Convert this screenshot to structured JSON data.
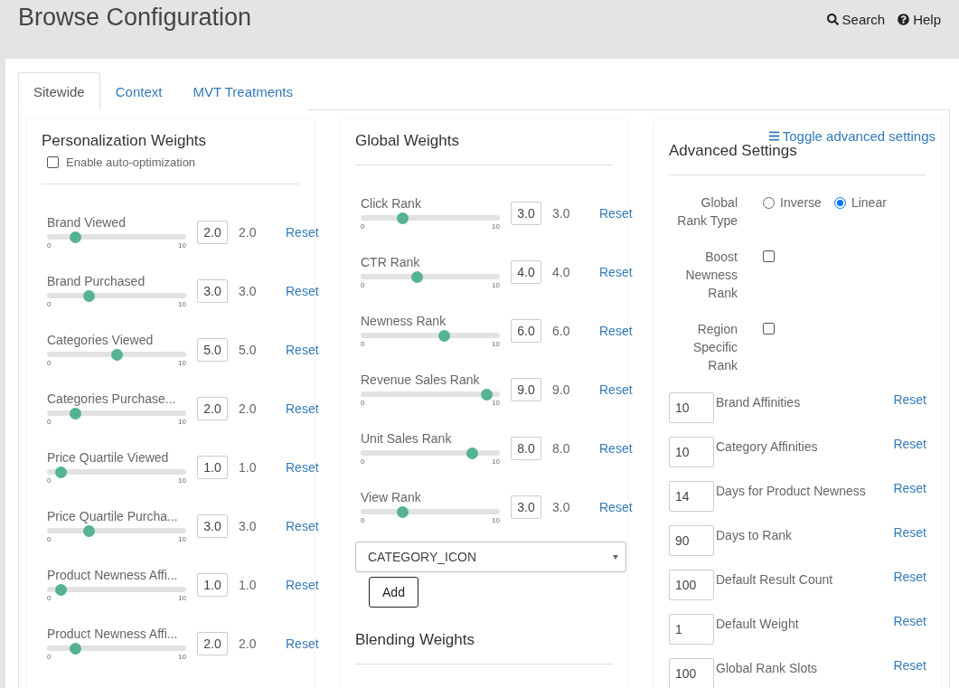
{
  "header": {
    "title": "Browse Configuration",
    "links": [
      {
        "kind": "search",
        "label": "Search"
      },
      {
        "kind": "help",
        "label": "Help"
      }
    ]
  },
  "tabs": [
    {
      "label": "Sitewide",
      "selected": true
    },
    {
      "label": "Context",
      "selected": false
    },
    {
      "label": "MVT Treatments",
      "selected": false
    }
  ],
  "personalization": {
    "title": "Personalization Weights",
    "auto_optimization": {
      "label": "Enable auto-optimization",
      "checked": false
    },
    "sliders": [
      {
        "label": "Brand Viewed",
        "level": 0.2,
        "min": "0",
        "max": "10",
        "input": "2.0",
        "value": "2.0",
        "reset": "Reset"
      },
      {
        "label": "Brand Purchased",
        "level": 0.3,
        "min": "0",
        "max": "10",
        "input": "3.0",
        "value": "3.0",
        "reset": "Reset"
      },
      {
        "label": "Categories Viewed",
        "level": 0.5,
        "min": "0",
        "max": "10",
        "input": "5.0",
        "value": "5.0",
        "reset": "Reset"
      },
      {
        "label": "Categories Purchase...",
        "level": 0.2,
        "min": "0",
        "max": "10",
        "input": "2.0",
        "value": "2.0",
        "reset": "Reset"
      },
      {
        "label": "Price Quartile Viewed",
        "level": 0.1,
        "min": "0",
        "max": "10",
        "input": "1.0",
        "value": "1.0",
        "reset": "Reset"
      },
      {
        "label": "Price Quartile Purcha...",
        "level": 0.3,
        "min": "0",
        "max": "10",
        "input": "3.0",
        "value": "3.0",
        "reset": "Reset"
      },
      {
        "label": "Product Newness Affi...",
        "level": 0.1,
        "min": "0",
        "max": "10",
        "input": "1.0",
        "value": "1.0",
        "reset": "Reset"
      },
      {
        "label": "Product Newness Affi...",
        "level": 0.2,
        "min": "0",
        "max": "10",
        "input": "2.0",
        "value": "2.0",
        "reset": "Reset"
      }
    ]
  },
  "global": {
    "title": "Global Weights",
    "sliders": [
      {
        "label": "Click Rank",
        "level": 0.3,
        "min": "0",
        "max": "10",
        "input": "3.0",
        "value": "3.0",
        "reset": "Reset"
      },
      {
        "label": "CTR Rank",
        "level": 0.4,
        "min": "0",
        "max": "10",
        "input": "4.0",
        "value": "4.0",
        "reset": "Reset"
      },
      {
        "label": "Newness Rank",
        "level": 0.6,
        "min": "0",
        "max": "10",
        "input": "6.0",
        "value": "6.0",
        "reset": "Reset"
      },
      {
        "label": "Revenue Sales Rank",
        "level": 0.9,
        "min": "0",
        "max": "10",
        "input": "9.0",
        "value": "9.0",
        "reset": "Reset"
      },
      {
        "label": "Unit Sales Rank",
        "level": 0.8,
        "min": "0",
        "max": "10",
        "input": "8.0",
        "value": "8.0",
        "reset": "Reset"
      },
      {
        "label": "View Rank",
        "level": 0.3,
        "min": "0",
        "max": "10",
        "input": "3.0",
        "value": "3.0",
        "reset": "Reset"
      }
    ],
    "select": {
      "value": "CATEGORY_ICON"
    },
    "add_button": "Add",
    "blending_title": "Blending Weights"
  },
  "advanced": {
    "toggle": "Toggle advanced settings",
    "title": "Advanced Settings",
    "rank_type": {
      "label": "Global Rank Type",
      "options": [
        {
          "label": "Inverse",
          "selected": false
        },
        {
          "label": "Linear",
          "selected": true
        }
      ]
    },
    "checks": [
      {
        "label": "Boost Newness Rank",
        "checked": false
      },
      {
        "label": "Region Specific Rank",
        "checked": false
      }
    ],
    "fields": [
      {
        "value": "10",
        "label": "Brand Affinities",
        "reset": "Reset"
      },
      {
        "value": "10",
        "label": "Category Affinities",
        "reset": "Reset"
      },
      {
        "value": "14",
        "label": "Days for Product Newness",
        "reset": "Reset"
      },
      {
        "value": "90",
        "label": "Days to Rank",
        "reset": "Reset"
      },
      {
        "value": "100",
        "label": "Default Result Count",
        "reset": "Reset"
      },
      {
        "value": "1",
        "label": "Default Weight",
        "reset": "Reset"
      },
      {
        "value": "100",
        "label": "Global Rank Slots",
        "reset": "Reset"
      }
    ]
  }
}
